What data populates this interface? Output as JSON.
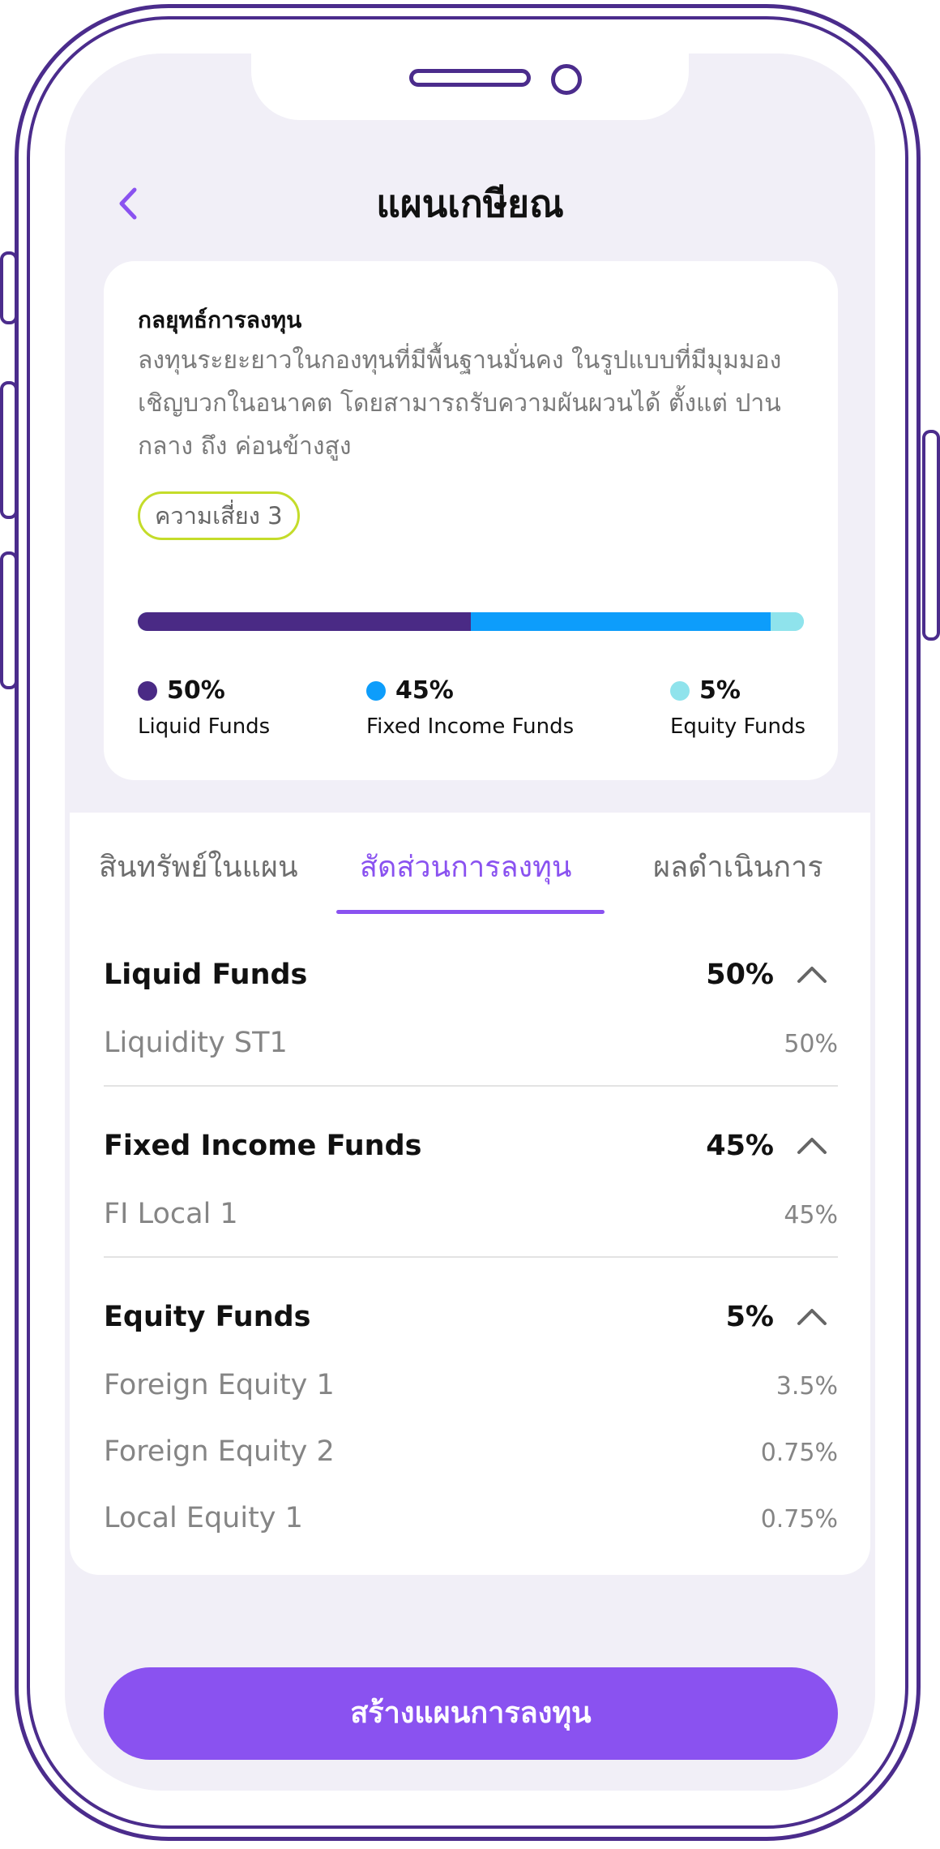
{
  "header": {
    "title": "แผนเกษียณ"
  },
  "strategy": {
    "title": "กลยุทธ์การลงทุน",
    "description": "ลงทุนระยะยาวในกองทุนที่มีพื้นฐานมั่นคง ในรูปแบบที่มีมุมมองเชิญบวกในอนาคต โดยสามารถรับความผันผวนได้ ตั้งแต่ ปานกลาง ถึง ค่อนข้างสูง",
    "risk_label": "ความเสี่ยง 3"
  },
  "allocation": [
    {
      "pct": "50%",
      "name": "Liquid Funds",
      "fraction": 0.5,
      "color": "#4a2a85"
    },
    {
      "pct": "45%",
      "name": "Fixed Income Funds",
      "fraction": 0.45,
      "color": "#0d9dfb"
    },
    {
      "pct": "5%",
      "name": "Equity Funds",
      "fraction": 0.05,
      "color": "#8fe3ec"
    }
  ],
  "tabs": [
    {
      "label": "สินทรัพย์ในแผน",
      "active": false
    },
    {
      "label": "สัดส่วนการลงทุน",
      "active": true
    },
    {
      "label": "ผลดำเนินการ",
      "active": false
    }
  ],
  "sections": [
    {
      "title": "Liquid Funds",
      "pct": "50%",
      "items": [
        {
          "name": "Liquidity ST1",
          "pct": "50%"
        }
      ]
    },
    {
      "title": "Fixed Income Funds",
      "pct": "45%",
      "items": [
        {
          "name": "FI Local 1",
          "pct": "45%"
        }
      ]
    },
    {
      "title": "Equity Funds",
      "pct": "5%",
      "items": [
        {
          "name": "Foreign Equity 1",
          "pct": "3.5%"
        },
        {
          "name": "Foreign Equity 2",
          "pct": "0.75%"
        },
        {
          "name": "Local Equity 1",
          "pct": "0.75%"
        }
      ]
    }
  ],
  "cta": {
    "label": "สร้างแผนการลงทุน"
  },
  "colors": {
    "accent": "#8a52f0",
    "frame": "#4b2c8c",
    "risk_border": "#c4dc2a"
  },
  "icons": {
    "back": "chevron-left-icon",
    "collapse": "chevron-up-icon"
  }
}
